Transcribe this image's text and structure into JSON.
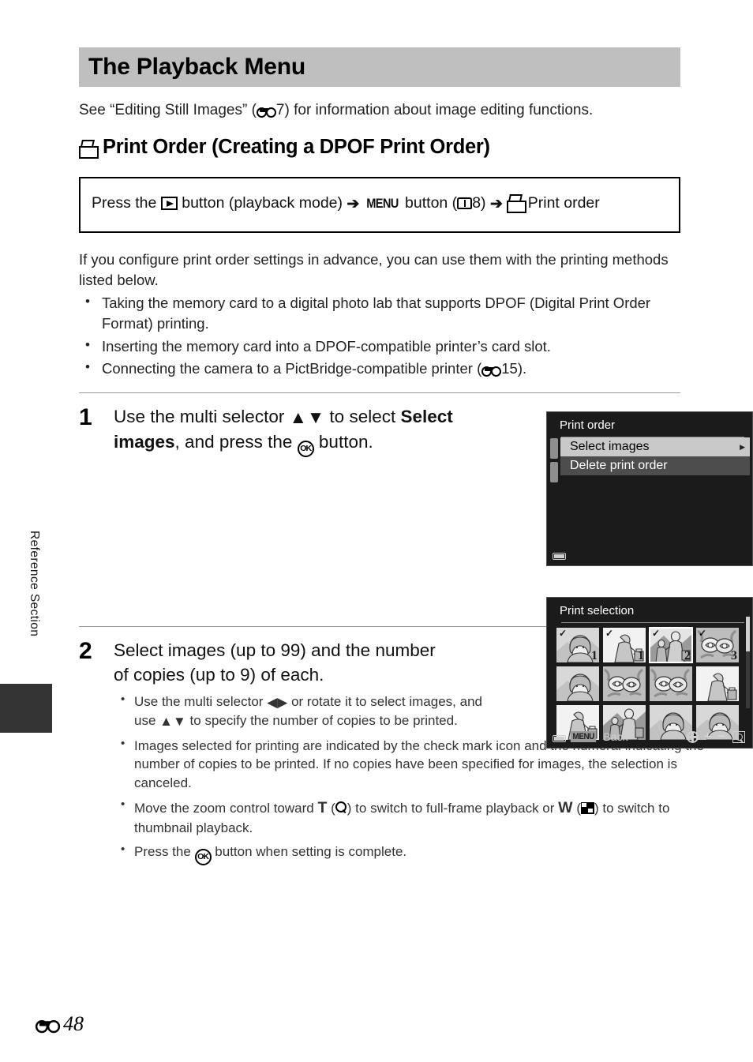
{
  "page": {
    "side_label": "Reference Section",
    "footer_page": "48",
    "footer_prefix_icon": "e-symbol-icon"
  },
  "header": {
    "title": "The Playback Menu",
    "intro_before": "See “Editing Still Images” (",
    "intro_ref": "7",
    "intro_after": ") for information about image editing functions."
  },
  "section": {
    "icon": "print-order-icon",
    "title": "Print Order (Creating a DPOF Print Order)"
  },
  "nav_box": {
    "t1": "Press the",
    "icon1": "playback-button-icon",
    "t2": "button (playback mode)",
    "arrow1": "➔",
    "menu_label": "MENU",
    "t3": "button (",
    "book_icon": "manual-book-icon",
    "book_ref": "8",
    "t4": ")",
    "arrow2": "➔",
    "icon2": "print-order-icon",
    "t5": "Print order"
  },
  "intro": {
    "paragraph": "If you configure print order settings in advance, you can use them with the printing methods listed below.",
    "bullets": [
      "Taking the memory card to a digital photo lab that supports DPOF (Digital Print Order Format) printing.",
      "Inserting the memory card into a DPOF-compatible printer’s card slot."
    ],
    "bullet3_before": "Connecting the camera to a PictBridge-compatible printer (",
    "bullet3_ref": "15",
    "bullet3_after": ")."
  },
  "steps": [
    {
      "number": "1",
      "title_a": "Use the multi selector",
      "title_updown": "▲▼",
      "title_b": "to select",
      "title_bold": "Select images",
      "title_c": ", and press the",
      "title_ok": "OK",
      "title_d": "button."
    },
    {
      "number": "2",
      "title": "Select images (up to 99) and the number of copies (up to 9) of each.",
      "bullets": {
        "b1_a": "Use the multi selector",
        "b1_lr": "◀▶",
        "b1_b": "or rotate it to select images, and use",
        "b1_ud": "▲▼",
        "b1_c": "to specify the number of copies to be printed.",
        "b2": "Images selected for printing are indicated by the check mark icon and the numeral indicating the number of copies to be printed. If no copies have been specified for images, the selection is canceled.",
        "b3_a": "Move the zoom control toward",
        "b3_t": "T",
        "b3_b": "(",
        "b3_mag": "magnifier-icon",
        "b3_c": ") to switch to full-frame playback or",
        "b3_w": "W",
        "b3_d": "(",
        "b3_thumb": "thumbnail-icon",
        "b3_e": ") to switch to thumbnail playback.",
        "b4_a": "Press the",
        "b4_ok": "OK",
        "b4_b": "button when setting is complete."
      }
    }
  ],
  "screens": {
    "print_order": {
      "title": "Print order",
      "items": [
        {
          "label": "Select images",
          "state": "selected",
          "has_caret": true
        },
        {
          "label": "Delete print order",
          "state": "normal",
          "has_caret": false
        }
      ],
      "battery_icon": "battery-icon"
    },
    "print_selection": {
      "title": "Print selection",
      "thumbnails": [
        {
          "checked": true,
          "copies": "1",
          "current": false,
          "art": "portrait"
        },
        {
          "checked": true,
          "copies": "1",
          "current": false,
          "art": "standing"
        },
        {
          "checked": true,
          "copies": "2",
          "current": true,
          "art": "couple"
        },
        {
          "checked": true,
          "copies": "3",
          "current": false,
          "art": "flowers"
        },
        {
          "checked": false,
          "copies": "",
          "current": false,
          "art": "portrait"
        },
        {
          "checked": false,
          "copies": "",
          "current": false,
          "art": "flowers"
        },
        {
          "checked": false,
          "copies": "",
          "current": false,
          "art": "flowers"
        },
        {
          "checked": false,
          "copies": "",
          "current": false,
          "art": "standing"
        },
        {
          "checked": false,
          "copies": "",
          "current": false,
          "art": "standing"
        },
        {
          "checked": false,
          "copies": "",
          "current": false,
          "art": "couple"
        },
        {
          "checked": false,
          "copies": "",
          "current": false,
          "art": "portrait"
        },
        {
          "checked": false,
          "copies": "",
          "current": false,
          "art": "portrait"
        }
      ],
      "bottom": {
        "menu_badge": "MENU",
        "back_label": "Back",
        "multiselector_icon": "multi-selector-icon",
        "plus_minus": "+ −",
        "zoom_icon": "zoom-magnifier-icon"
      },
      "battery_icon": "battery-icon"
    }
  }
}
